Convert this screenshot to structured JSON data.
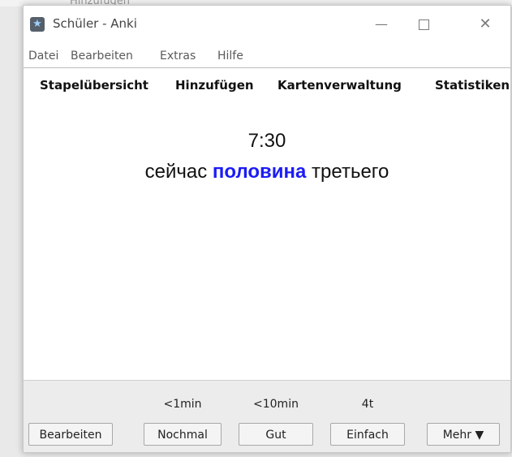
{
  "window": {
    "title": "Schüler - Anki",
    "minimize_glyph": "—",
    "close_glyph": "✕",
    "background_ghost_text": "Hinzufügen"
  },
  "menu": {
    "items": [
      "Datei",
      "Bearbeiten",
      "Extras",
      "Hilfe"
    ]
  },
  "toolbar": {
    "items": [
      "Stapelübersicht",
      "Hinzufügen",
      "Kartenverwaltung",
      "Statistiken"
    ]
  },
  "card": {
    "front": "7:30",
    "back_prefix": "сейчас ",
    "back_highlight": "половина",
    "back_suffix": " третьего",
    "highlight_color": "#1c1cf5"
  },
  "answer": {
    "due": [
      "<1min",
      "<10min",
      "4t"
    ],
    "edit_label": "Bearbeiten",
    "again_label": "Nochmal",
    "good_label": "Gut",
    "easy_label": "Einfach",
    "more_label": "Mehr ▼"
  },
  "icons": {
    "app": "anki-star-icon",
    "minimize": "minimize-icon",
    "maximize": "maximize-icon",
    "close": "close-icon"
  }
}
